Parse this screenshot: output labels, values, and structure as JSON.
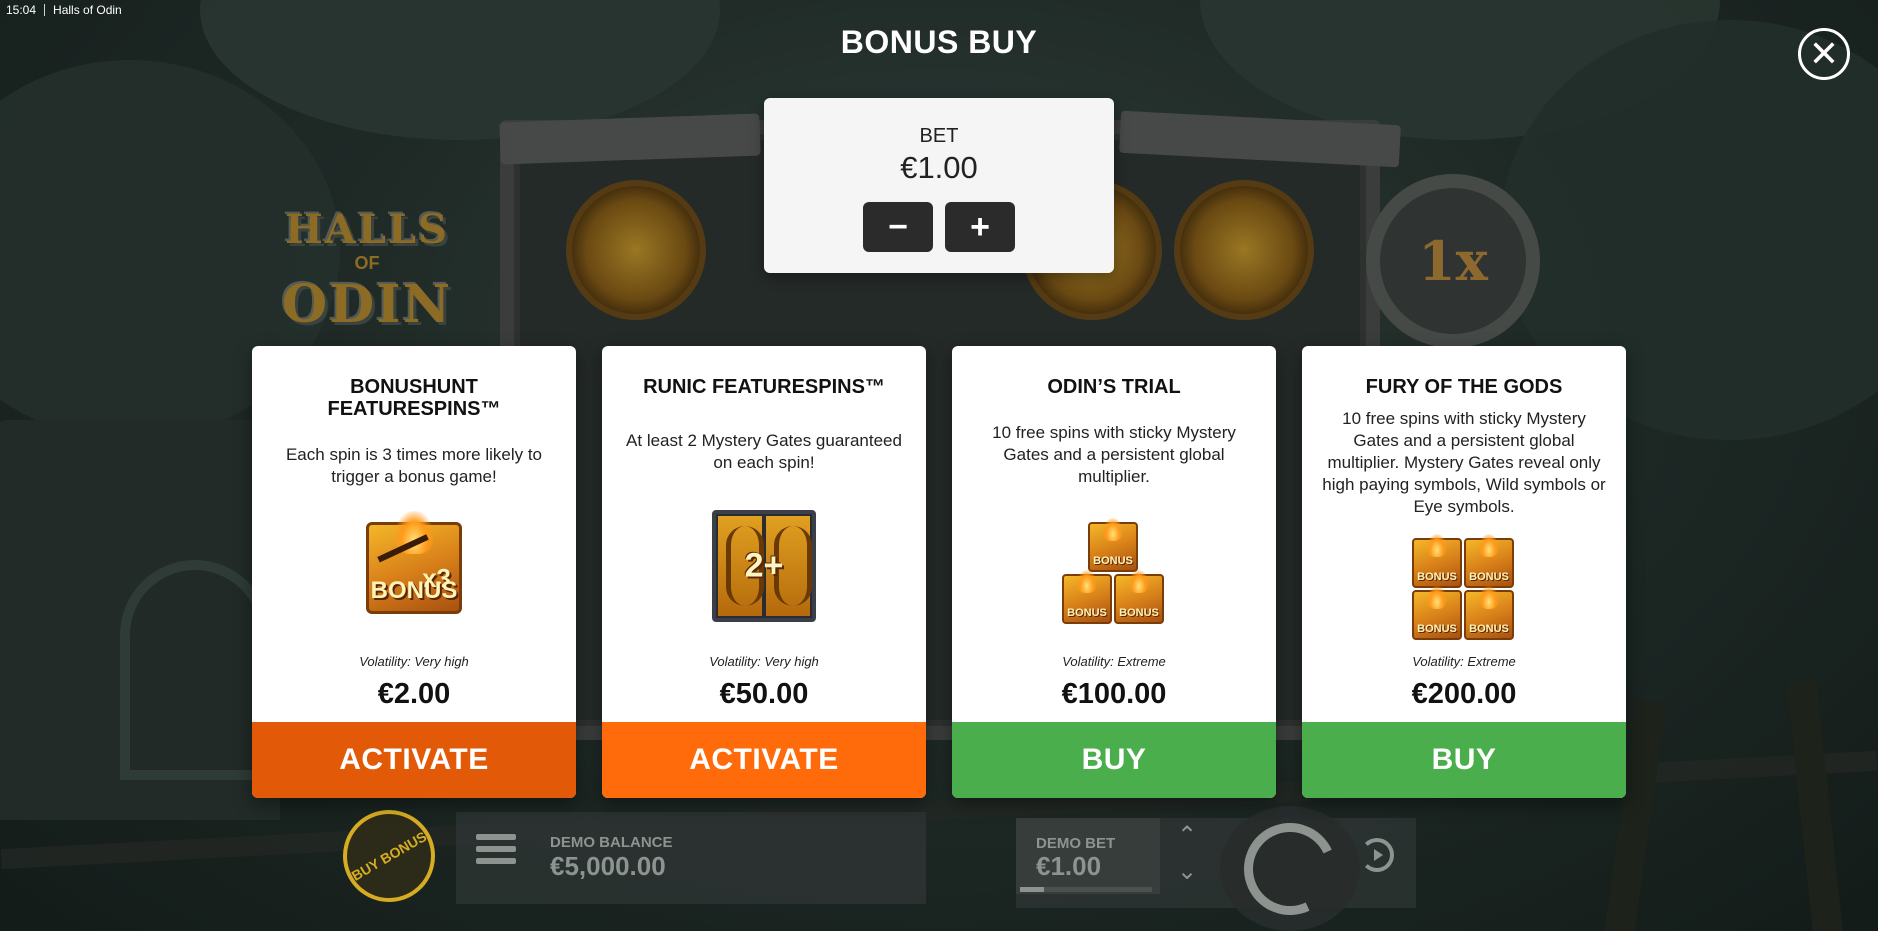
{
  "status_bar": {
    "time": "15:04",
    "app_title": "Halls of Odin"
  },
  "modal": {
    "title": "BONUS BUY",
    "close_icon": "close-icon",
    "bet": {
      "label": "BET",
      "value": "€1.00",
      "decrease": "−",
      "increase": "+"
    }
  },
  "background": {
    "logo_line1": "HALLS",
    "logo_line2": "OF",
    "logo_line3": "ODIN",
    "multiplier": "1x"
  },
  "cards": [
    {
      "title": "BONUSHUNT FEATURESPINS™",
      "description": "Each spin is 3 times more likely to trigger a bonus game!",
      "icon": "bonushunt-x3-bonus-icon",
      "icon_text_mult": "x3",
      "icon_text_word": "BONUS",
      "volatility": "Volatility: Very high",
      "price": "€2.00",
      "action": "ACTIVATE",
      "action_color": "#e25a08"
    },
    {
      "title": "RUNIC FEATURESPINS™",
      "description": "At least 2 Mystery Gates guaranteed on each spin!",
      "icon": "mystery-gates-2plus-icon",
      "icon_text_badge": "2+",
      "volatility": "Volatility: Very high",
      "price": "€50.00",
      "action": "ACTIVATE",
      "action_color": "#ff6a0a"
    },
    {
      "title": "ODIN’S TRIAL",
      "description": "10 free spins with sticky Mystery Gates and a persistent global multiplier.",
      "icon": "three-bonus-tiles-icon",
      "icon_text_word": "BONUS",
      "volatility": "Volatility: Extreme",
      "price": "€100.00",
      "action": "BUY",
      "action_color": "#4aae4c"
    },
    {
      "title": "FURY OF THE GODS",
      "description": "10 free spins with sticky Mystery Gates and a persistent global multiplier. Mystery Gates reveal only high paying symbols, Wild symbols or Eye symbols.",
      "icon": "four-bonus-tiles-icon",
      "icon_text_word": "BONUS",
      "volatility": "Volatility: Extreme",
      "price": "€200.00",
      "action": "BUY",
      "action_color": "#4aae4c"
    }
  ],
  "hud": {
    "buy_bonus": "BUY BONUS",
    "menu_icon": "hamburger-menu-icon",
    "balance_label": "DEMO BALANCE",
    "balance_value": "€5,000.00",
    "bet_label": "DEMO BET",
    "bet_value": "€1.00",
    "bet_level_fraction": 0.18,
    "up_arrow": "⌃",
    "down_arrow": "⌄",
    "spin_icon": "spin-icon",
    "autoplay_icon": "autoplay-icon"
  }
}
